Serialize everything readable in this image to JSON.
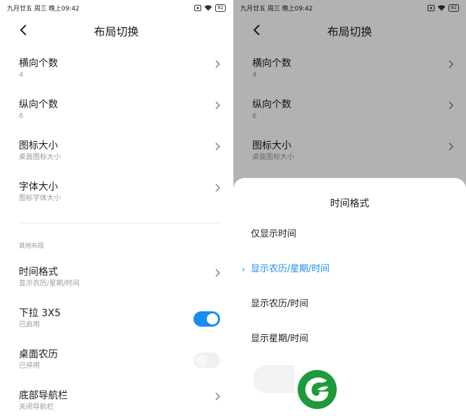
{
  "status": {
    "datetime": "九月廿五 周三 晚上09:42",
    "battery": "92"
  },
  "header": {
    "title": "布局切换"
  },
  "rows": [
    {
      "title": "横向个数",
      "sub": "4"
    },
    {
      "title": "纵向个数",
      "sub": "6"
    },
    {
      "title": "图标大小",
      "sub": "桌面图标大小"
    },
    {
      "title": "字体大小",
      "sub": "图标字体大小"
    }
  ],
  "section": {
    "label": "其他布局"
  },
  "other_rows": [
    {
      "title": "时间格式",
      "sub": "显示农历/星期/时间",
      "control": "chevron"
    },
    {
      "title": "下拉 3X5",
      "sub": "已启用",
      "control": "toggle",
      "on": true
    },
    {
      "title": "桌面农历",
      "sub": "已停用",
      "control": "toggle",
      "on": false
    },
    {
      "title": "底部导航栏",
      "sub": "关闭导航栏",
      "control": "chevron"
    }
  ],
  "dialog": {
    "title": "时间格式",
    "options": [
      "仅显示时间",
      "显示农历/星期/时间",
      "显示农历/时间",
      "显示星期/时间"
    ],
    "selected_index": 1
  },
  "colors": {
    "accent": "#1a8bf0",
    "logo": "#1e9a3a"
  },
  "icons": {
    "back": "chevron-left-icon",
    "row": "chevron-right-icon",
    "check": "chevron-right-small-icon"
  }
}
